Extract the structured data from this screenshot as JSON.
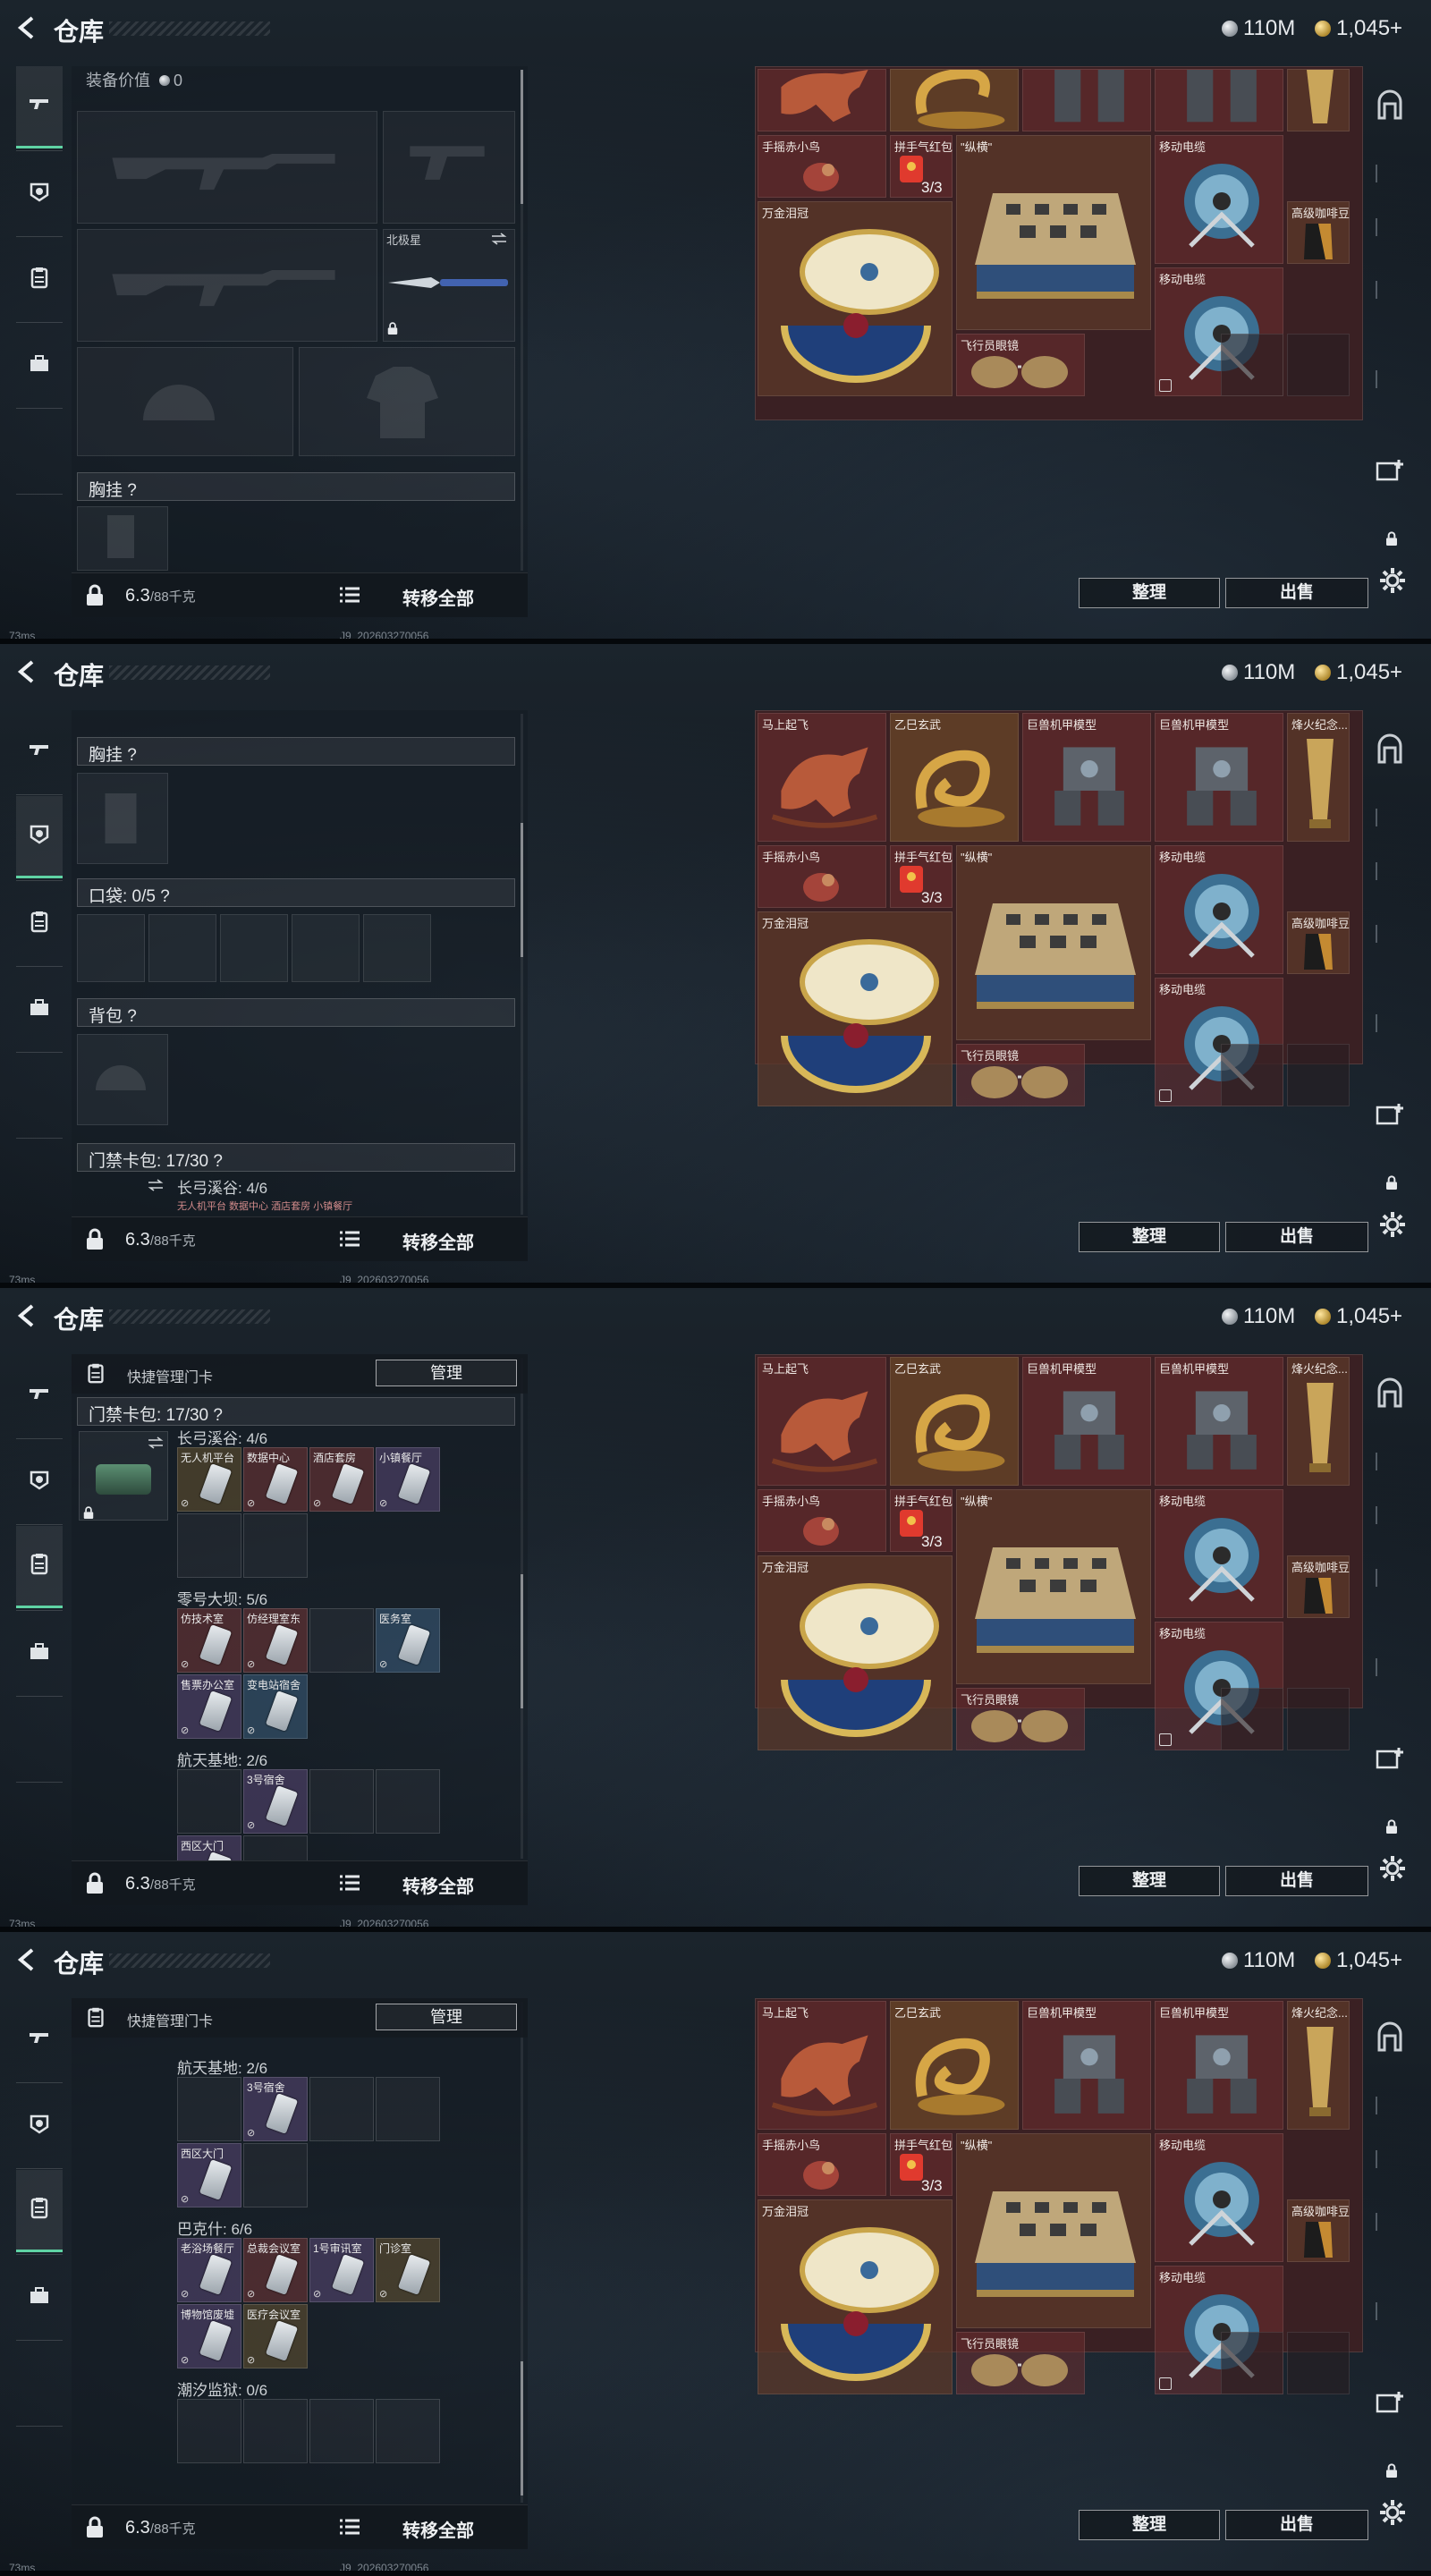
{
  "header": {
    "title": "仓库",
    "silver_amount": "110M",
    "gold_amount": "1,045+"
  },
  "left": {
    "equipment_value_label": "装备价值",
    "equipment_value": "0",
    "melee_name": "北极星",
    "chest_rig_header": "胸挂 ?",
    "pocket_header": "口袋: 0/5 ?",
    "backpack_header": "背包 ?",
    "keycard_header": "门禁卡包: 17/30 ?",
    "weight_value": "6.3",
    "weight_unit": "/88千克",
    "transfer_all": "转移全部",
    "manage_label": "快捷管理门卡",
    "manage_button": "管理",
    "preview_group": "长弓溪谷: 4/6",
    "preview_cards": "无人机平台  数据中心  酒店套房  小镇餐厅"
  },
  "keycards": {
    "groups": [
      {
        "title": "长弓溪谷: 4/6",
        "cards": [
          {
            "label": "无人机平台",
            "color": "gold"
          },
          {
            "label": "数据中心",
            "color": "red"
          },
          {
            "label": "酒店套房",
            "color": "red"
          },
          {
            "label": "小镇餐厅",
            "color": "purple"
          }
        ]
      },
      {
        "title": "零号大坝: 5/6",
        "cards": [
          {
            "label": "仿技术室",
            "color": "red"
          },
          {
            "label": "仿经理室东",
            "color": "red"
          },
          {
            "label": "",
            "color": "empty"
          },
          {
            "label": "医务室",
            "color": "blue"
          },
          {
            "label": "售票办公室",
            "color": "purple"
          },
          {
            "label": "变电站宿舍",
            "color": "blue"
          }
        ]
      },
      {
        "title": "航天基地: 2/6",
        "cards": [
          {
            "label": "",
            "color": "empty"
          },
          {
            "label": "3号宿舍",
            "color": "purple"
          },
          {
            "label": "",
            "color": "empty"
          },
          {
            "label": "",
            "color": "empty"
          },
          {
            "label": "西区大门",
            "color": "purple"
          },
          {
            "label": "",
            "color": "empty"
          }
        ]
      },
      {
        "title": "巴克什: 6/6",
        "cards": [
          {
            "label": "老浴场餐厅",
            "color": "purple"
          },
          {
            "label": "总裁会议室",
            "color": "red"
          },
          {
            "label": "1号审讯室",
            "color": "purple"
          },
          {
            "label": "门诊室",
            "color": "gold"
          },
          {
            "label": "博物馆废墟",
            "color": "purple"
          },
          {
            "label": "医疗会议室",
            "color": "gold"
          }
        ]
      },
      {
        "title": "潮汐监狱: 0/6"
      }
    ]
  },
  "grid": {
    "items": {
      "horse": "马上起飞",
      "dragon": "乙巳玄武",
      "mech1": "巨兽机甲模型",
      "mech2": "巨兽机甲模型",
      "torch": "烽火纪念...",
      "bird": "手摇赤小鸟",
      "redpack": "拼手气红包",
      "redpack_count": "3/3",
      "chess": "\"纵横\"",
      "reel1": "移动电缆",
      "coffee": "高级咖啡豆",
      "egg": "万金泪冠",
      "reel2": "移动电缆",
      "glasses": "飞行员眼镜"
    },
    "sort_button": "整理",
    "sell_button": "出售"
  },
  "status": {
    "ping": "73ms",
    "build": "J9_202603270056"
  },
  "icons": [
    "back-arrow-icon",
    "silver-coin-icon",
    "gold-coin-icon",
    "gun-icon",
    "helmet-icon",
    "clipboard-icon",
    "toolbox-icon",
    "lock-icon",
    "list-icon",
    "settings-icon",
    "swap-icon"
  ]
}
